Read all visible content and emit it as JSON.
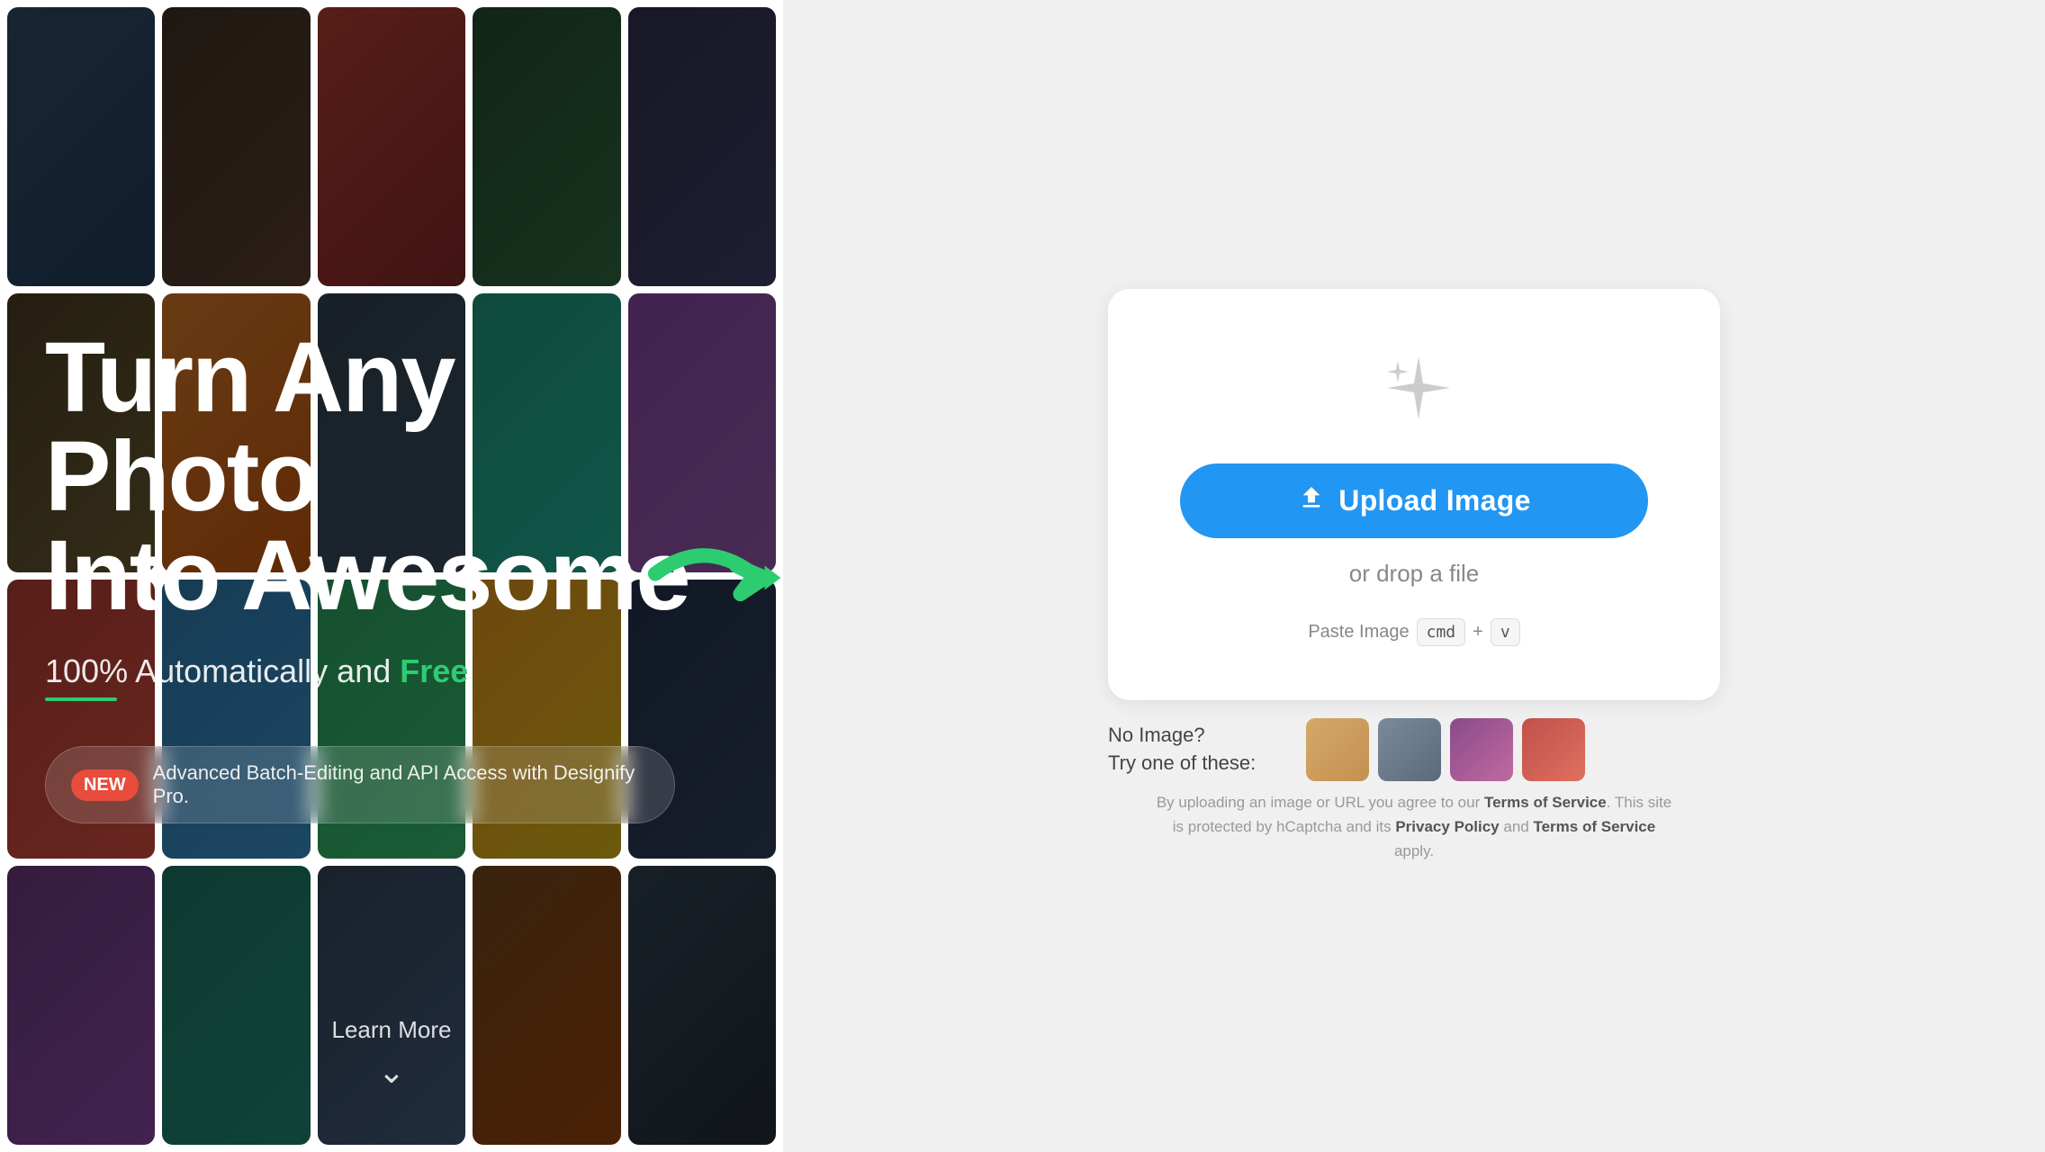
{
  "left": {
    "heading_line1": "Turn Any Photo",
    "heading_line2": "Into Awesome",
    "subtitle_text": "100% Automatically and ",
    "subtitle_free": "Free",
    "new_badge": "NEW",
    "new_message": "Advanced Batch-Editing and API Access with Designify Pro.",
    "learn_more": "Learn More",
    "chevron": "∨"
  },
  "right": {
    "upload_button": "Upload Image",
    "drop_text": "or drop a file",
    "paste_label": "Paste Image",
    "paste_key1": "cmd",
    "paste_plus": "+",
    "paste_key2": "v",
    "no_image_line1": "No Image?",
    "no_image_line2": "Try one of these:",
    "terms_text": "By uploading an image or URL you agree to our ",
    "terms_link1": "Terms of Service",
    "terms_mid1": ". This site is protected by hCaptcha and its ",
    "terms_link2": "Privacy Policy",
    "terms_mid2": " and ",
    "terms_link3": "Terms of Service",
    "terms_end": " apply."
  },
  "colors": {
    "upload_btn_bg": "#2196F3",
    "free_color": "#2ecc71",
    "new_badge_bg": "#e74c3c"
  }
}
